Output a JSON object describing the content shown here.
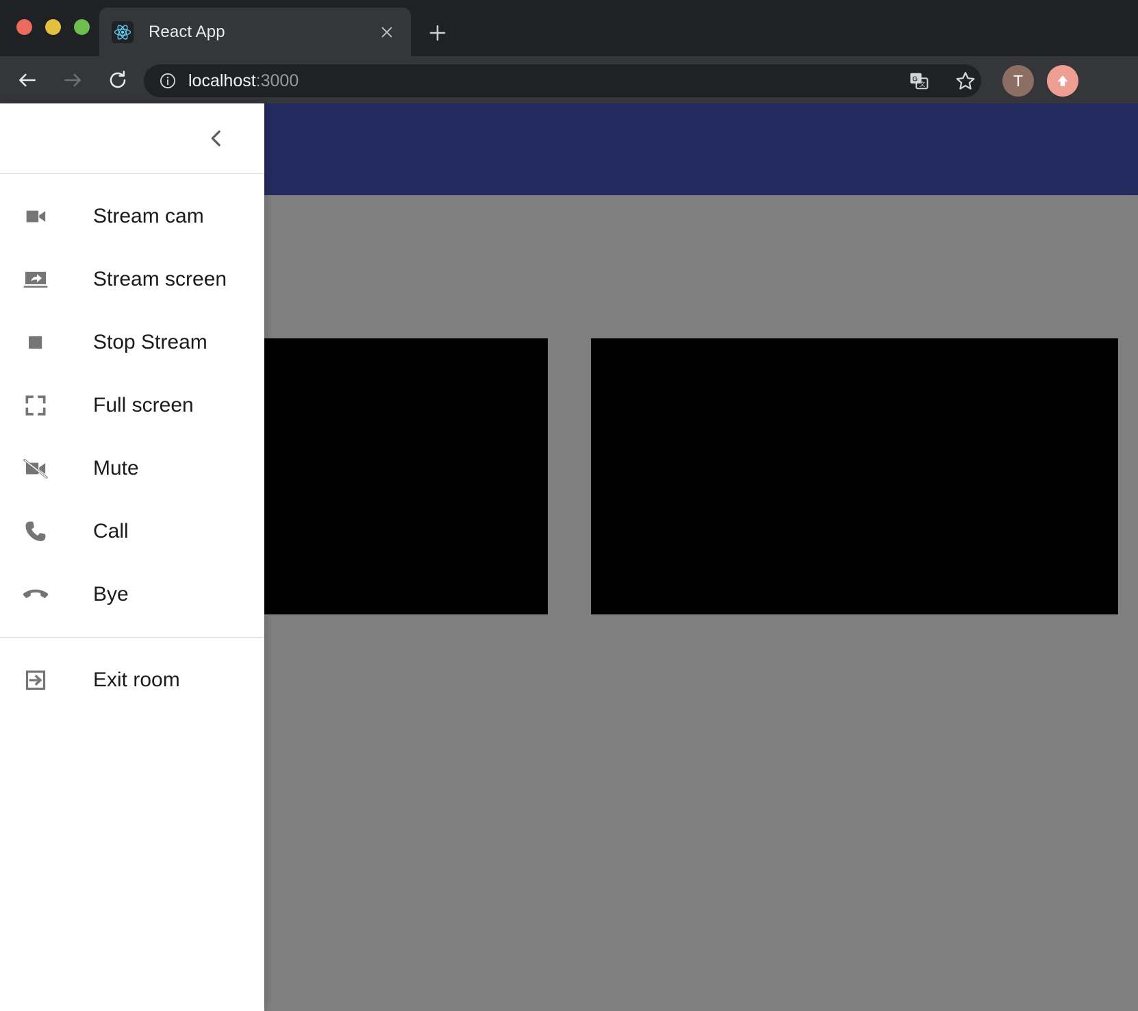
{
  "browser": {
    "window_controls": [
      {
        "name": "close",
        "color": "#ed6a5e"
      },
      {
        "name": "minimize",
        "color": "#e3c040"
      },
      {
        "name": "maximize",
        "color": "#6ebe4e"
      }
    ],
    "tab": {
      "title": "React App",
      "favicon": "react-logo-icon",
      "close_icon": "close-icon"
    },
    "new_tab_icon": "plus-icon",
    "back_icon": "arrow-left-icon",
    "forward_icon": "arrow-right-icon",
    "reload_icon": "reload-icon",
    "omnibox": {
      "info_icon": "info-circle-icon",
      "url_host": "localhost",
      "url_port": ":3000"
    },
    "translate_icon": "translate-icon",
    "bookmark_icon": "star-outline-icon",
    "profile_initial": "T",
    "update_icon": "arrow-up-icon"
  },
  "drawer": {
    "collapse_icon": "chevron-left-icon",
    "items": [
      {
        "label": "Stream cam",
        "icon": "videocam-icon"
      },
      {
        "label": "Stream screen",
        "icon": "screen-share-icon"
      },
      {
        "label": "Stop Stream",
        "icon": "stop-square-icon"
      },
      {
        "label": "Full screen",
        "icon": "fullscreen-icon"
      },
      {
        "label": "Mute",
        "icon": "videocam-off-icon"
      },
      {
        "label": "Call",
        "icon": "phone-icon"
      },
      {
        "label": "Bye",
        "icon": "call-end-icon"
      }
    ],
    "bottom_items": [
      {
        "label": "Exit room",
        "icon": "exit-to-app-icon"
      }
    ]
  },
  "app": {
    "appbar_color": "#242b5e",
    "stage_color": "#808080",
    "tiles": [
      {
        "name": "local-video",
        "color": "#000000"
      },
      {
        "name": "remote-video",
        "color": "#000000"
      }
    ]
  }
}
